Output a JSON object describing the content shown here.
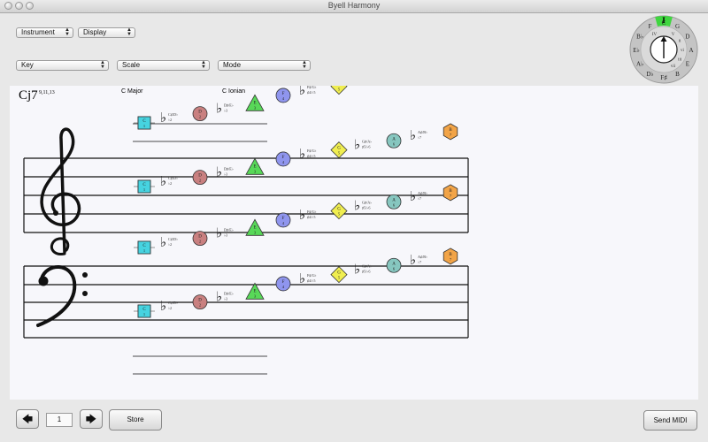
{
  "window": {
    "title": "Byell Harmony"
  },
  "controls": {
    "instrument_label": "Instrument",
    "display_label": "Display",
    "key_label": "Key",
    "scale_label": "Scale",
    "mode_label": "Mode"
  },
  "header": {
    "chord_name": "Cj7",
    "chord_ext": "9,11,13",
    "key_scale": "C Major",
    "mode_name": "C Ionian"
  },
  "circle": {
    "center": "I",
    "notes": [
      "C",
      "G",
      "D",
      "A",
      "E",
      "B",
      "F♯",
      "D♭",
      "A♭",
      "E♭",
      "B♭",
      "F"
    ],
    "degrees": [
      "I",
      "V",
      "ii",
      "vi",
      "iii",
      "vii",
      "IV"
    ],
    "highlight_color": "#3fd63f"
  },
  "notation": {
    "degrees": [
      {
        "note": "C",
        "num": "1",
        "shape": "square",
        "color": "#46d3e0"
      },
      {
        "note": "D",
        "num": "2",
        "shape": "circle",
        "color": "#c98080"
      },
      {
        "note": "E",
        "num": "3",
        "shape": "triangle",
        "color": "#58d858"
      },
      {
        "note": "F",
        "num": "4",
        "shape": "circle",
        "color": "#8f95ee"
      },
      {
        "note": "G",
        "num": "5",
        "shape": "diamond",
        "color": "#f0ee50"
      },
      {
        "note": "A",
        "num": "6",
        "shape": "circle",
        "color": "#86c6bf"
      },
      {
        "note": "B",
        "num": "7",
        "shape": "hexagon",
        "color": "#f2a447"
      }
    ],
    "flat_labels": [
      "C♯/D♭",
      "D♯/E♭",
      "F♯/G♭",
      "G♯/A♭",
      "A♯/B♭"
    ],
    "flat_degrees": [
      "♭2",
      "♭3",
      "♯4/♭5",
      "♯5/♭6",
      "♭7"
    ]
  },
  "footer": {
    "prev_icon": "left-arrow-icon",
    "next_icon": "right-arrow-icon",
    "page": "1",
    "store_label": "Store",
    "send_label": "Send MIDI"
  }
}
